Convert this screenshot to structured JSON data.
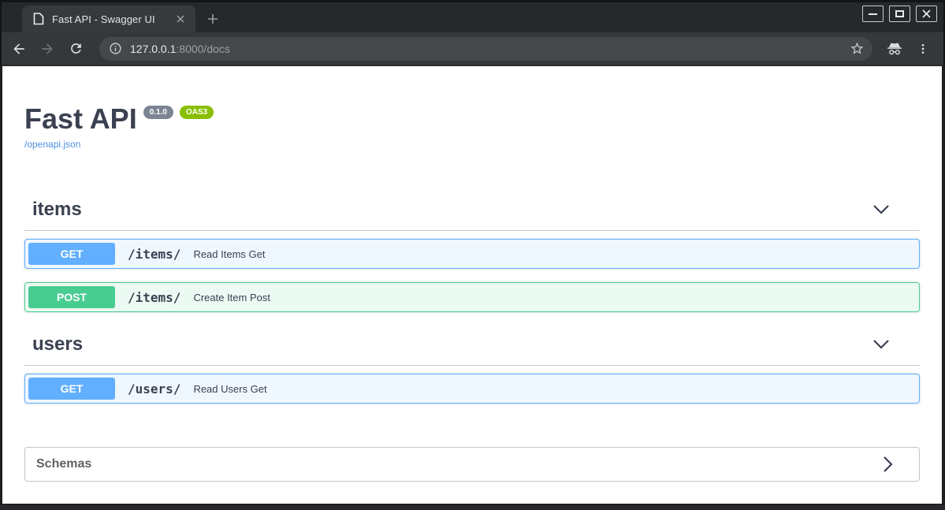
{
  "window": {
    "tab": {
      "title": "Fast API - Swagger UI"
    }
  },
  "browser": {
    "url": {
      "host": "127.0.0.1",
      "rest": ":8000/docs"
    }
  },
  "page": {
    "title": "Fast API",
    "badges": {
      "version": "0.1.0",
      "oas": "OAS3"
    },
    "spec_link": "/openapi.json",
    "sections": [
      {
        "name": "items",
        "operations": [
          {
            "method": "GET",
            "path": "/items/",
            "summary": "Read Items Get"
          },
          {
            "method": "POST",
            "path": "/items/",
            "summary": "Create Item Post"
          }
        ]
      },
      {
        "name": "users",
        "operations": [
          {
            "method": "GET",
            "path": "/users/",
            "summary": "Read Users Get"
          }
        ]
      }
    ],
    "schemas_label": "Schemas"
  },
  "icons": {
    "tab_favicon": "document-icon",
    "back": "back-arrow-icon",
    "forward": "forward-arrow-icon",
    "reload": "reload-icon",
    "site_info": "info-icon",
    "bookmark": "star-icon",
    "incognito": "incognito-icon",
    "menu": "kebab-menu-icon",
    "expand": "chevron-down-icon",
    "collapse_right": "chevron-right-icon"
  },
  "colors": {
    "get": "#61affe",
    "get-bg": "#eff7ff",
    "post": "#49cc90",
    "post-bg": "#ecfaf4",
    "badge-version-bg": "#7d8492",
    "badge-oas-bg": "#89bf04",
    "link": "#4990e2",
    "heading": "#3b4151"
  }
}
